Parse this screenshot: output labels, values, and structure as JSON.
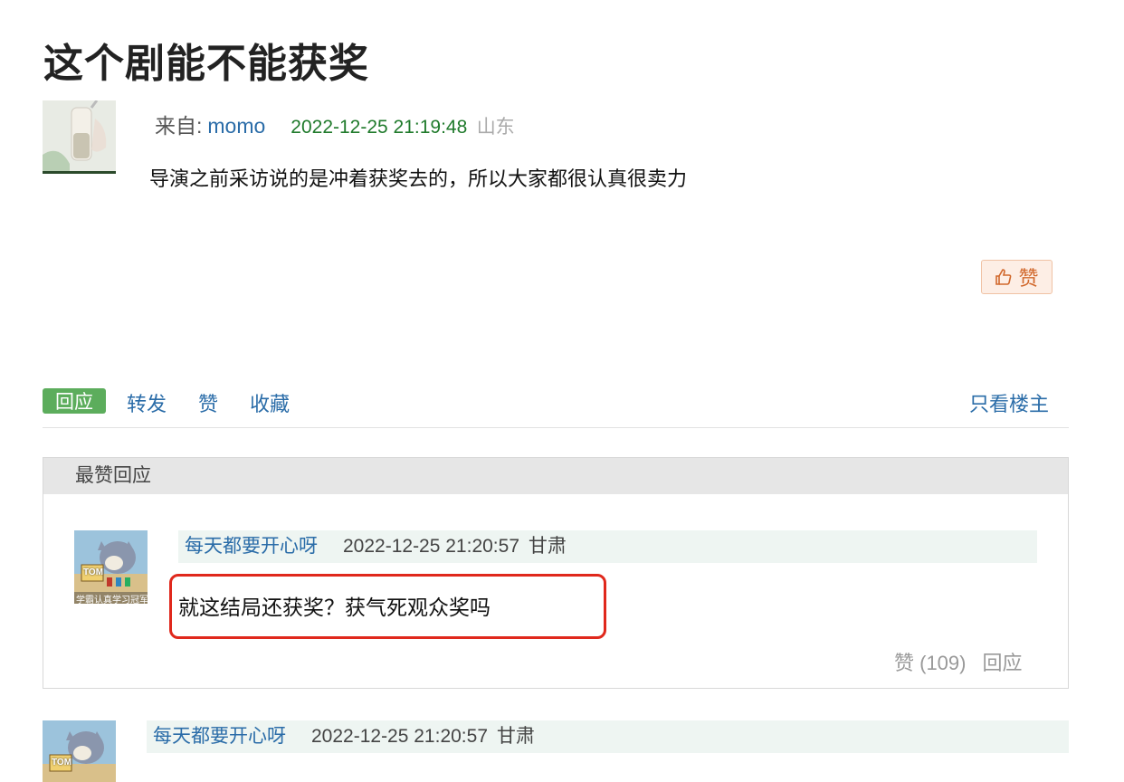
{
  "post": {
    "title": "这个剧能不能获奖",
    "from_label": "来自:",
    "author": "momo",
    "timestamp": "2022-12-25 21:19:48",
    "location": "山东",
    "content": "导演之前采访说的是冲着获奖去的，所以大家都很认真很卖力",
    "like_button_label": "赞"
  },
  "actions": {
    "reply": "回应",
    "repost": "转发",
    "like": "赞",
    "collect": "收藏",
    "only_op": "只看楼主"
  },
  "best_replies": {
    "header": "最赞回应",
    "items": [
      {
        "user": "每天都要开心呀",
        "timestamp": "2022-12-25 21:20:57",
        "location": "甘肃",
        "content": "就这结局还获奖？获气死观众奖吗",
        "like_label": "赞 (109)",
        "reply_label": "回应",
        "avatar_caption": "学霸认真学习冠军",
        "avatar_badge": "TOM"
      }
    ]
  },
  "replies": [
    {
      "user": "每天都要开心呀",
      "timestamp": "2022-12-25 21:20:57",
      "location": "甘肃",
      "avatar_badge": "TOM"
    }
  ],
  "colors": {
    "link": "#2a6ca8",
    "timestamp_green": "#1f7a2b",
    "reply_button": "#5cad5c",
    "highlight_border": "#e0281c",
    "like_button_bg": "#fdeee5"
  }
}
